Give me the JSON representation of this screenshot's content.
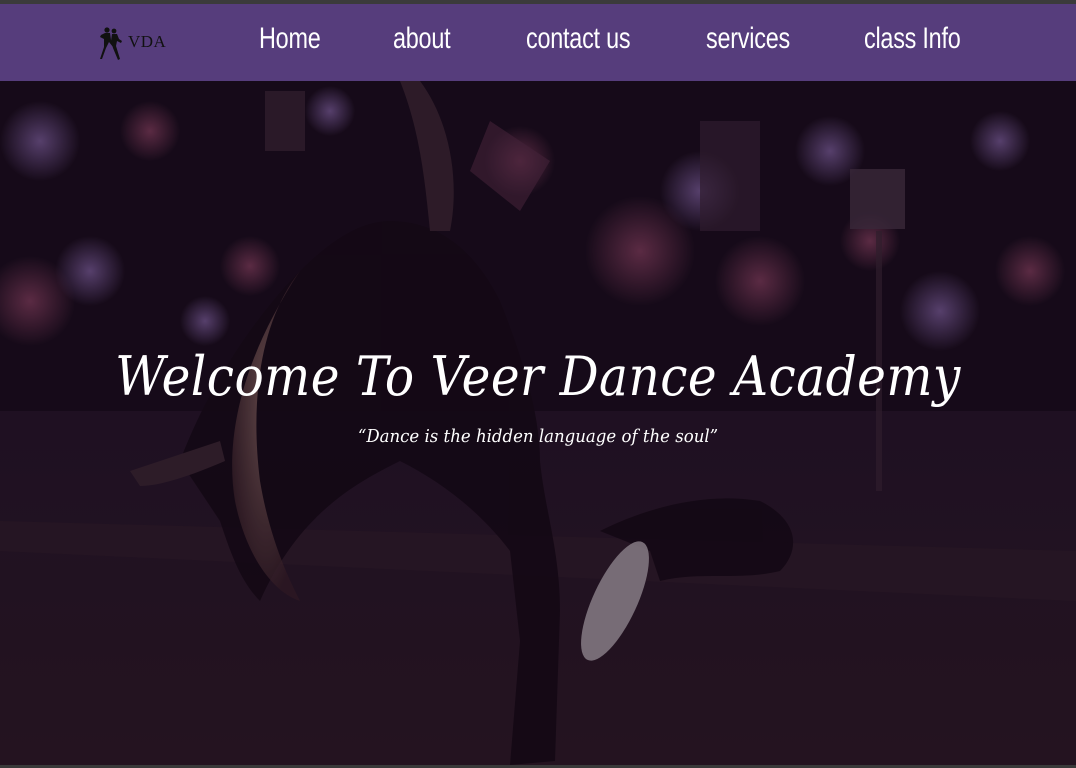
{
  "navbar": {
    "logo_text": "VDA",
    "links": [
      "Home",
      "about",
      "contact us",
      "services",
      "class Info"
    ]
  },
  "hero": {
    "title": "Welcome To Veer Dance Academy",
    "quote": "“Dance is the hidden language of the soul”",
    "background": "photo of a woman dancing, arching backward on a night city street with bokeh lights"
  },
  "colors": {
    "navbar": "#563d7c",
    "overlay": "#1a0f1c",
    "text": "#ffffff"
  }
}
